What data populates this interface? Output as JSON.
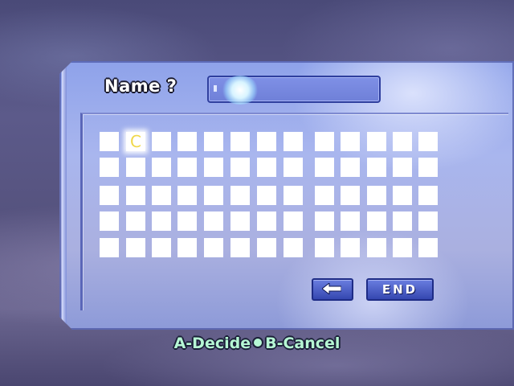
{
  "window": {
    "name_label": "Name ?",
    "name_value": ""
  },
  "grid": {
    "rows": [
      [
        "",
        "C",
        "",
        "",
        "",
        "",
        "",
        "",
        "",
        "",
        "",
        "",
        ""
      ],
      [
        "",
        "",
        "",
        "",
        "",
        "",
        "",
        "",
        "",
        "",
        "",
        "",
        ""
      ],
      [
        "",
        "",
        "",
        "",
        "",
        "",
        "",
        "",
        "",
        "",
        "",
        "",
        ""
      ],
      [
        "",
        "",
        "",
        "",
        "",
        "",
        "",
        "",
        "",
        "",
        "",
        "",
        ""
      ],
      [
        "",
        "",
        "",
        "",
        "",
        "",
        "",
        "",
        "",
        "",
        "",
        "",
        ""
      ]
    ],
    "selected": {
      "row": 0,
      "col": 1
    }
  },
  "buttons": {
    "backspace_icon": "left-arrow-icon",
    "end_label": "END"
  },
  "hint": {
    "decide": "A-Decide",
    "cancel": "B-Cancel"
  },
  "colors": {
    "hint_text": "#b6f7d4",
    "selected_char": "#f0d84a",
    "button_fill": "#3547b0"
  }
}
